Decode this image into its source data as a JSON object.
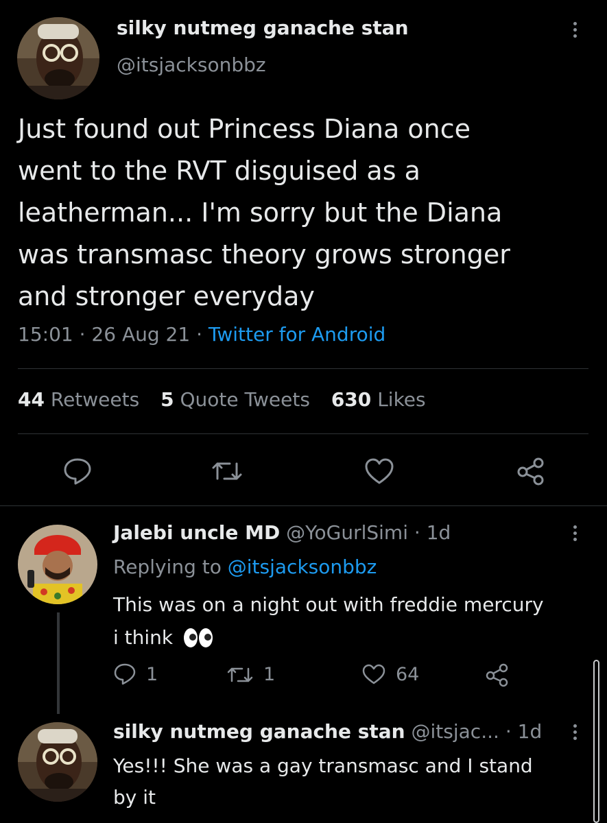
{
  "main_tweet": {
    "display_name": "silky nutmeg ganache stan",
    "handle": "@itsjacksonbbz",
    "text_lines": [
      "Just found out Princess Diana once",
      "went to the RVT disguised as a",
      "leatherman... I'm sorry but the Diana",
      "was transmasc theory grows stronger",
      "and stronger everyday"
    ],
    "time": "15:01",
    "sep1": "·",
    "date": "26 Aug 21",
    "sep2": "·",
    "source": "Twitter for Android",
    "stats": {
      "retweets_count": "44",
      "retweets_label": "Retweets",
      "quotes_count": "5",
      "quotes_label": "Quote Tweets",
      "likes_count": "630",
      "likes_label": "Likes"
    }
  },
  "reply1": {
    "display_name": "Jalebi uncle MD",
    "handle": "@YoGurlSimi",
    "sep": "·",
    "age": "1d",
    "replying_prefix": "Replying to",
    "replying_handle": "@itsjacksonbbz",
    "text_line1": "This was on a night out with freddie mercury",
    "text_line2": "i think",
    "reply_count": "1",
    "retweet_count": "1",
    "like_count": "64"
  },
  "reply2": {
    "display_name": "silky nutmeg ganache stan",
    "handle": "@itsjac...",
    "sep": "·",
    "age": "1d",
    "text_line1": "Yes!!! She was a gay transmasc and I stand",
    "text_line2": "by it"
  },
  "icons": [
    "reply-icon",
    "retweet-icon",
    "like-icon",
    "share-icon",
    "more-icon",
    "eyes-emoji-icon"
  ]
}
